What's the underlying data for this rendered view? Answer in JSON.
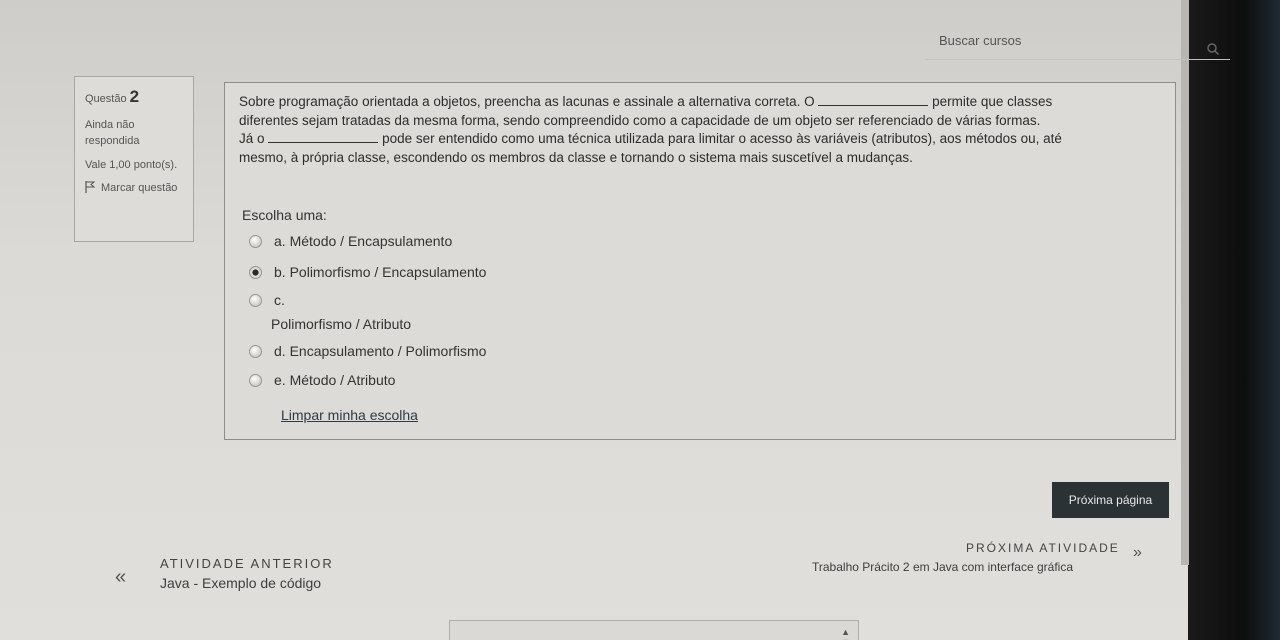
{
  "search": {
    "placeholder": "Buscar cursos"
  },
  "question_info": {
    "label": "Questão",
    "number": "2",
    "status": "Ainda não respondida",
    "grade": "Vale 1,00 ponto(s).",
    "flag_label": "Marcar questão"
  },
  "question": {
    "line1": "Sobre programação orientada a objetos, preencha as lacunas e assinale a alternativa correta. O",
    "line1_end": "permite que classes",
    "line2": "diferentes sejam tratadas da mesma forma, sendo compreendido como a capacidade de um objeto ser referenciado de várias formas.",
    "line3_start": "Já o",
    "line3_end": "pode ser entendido como uma técnica utilizada para limitar o acesso às variáveis (atributos), aos métodos ou, até",
    "line4": "mesmo, à própria classe, escondendo os membros da classe e tornando o sistema mais suscetível a mudanças.",
    "choose_label": "Escolha uma:",
    "options": [
      {
        "letter": "a.",
        "text": "Método / Encapsulamento",
        "selected": false
      },
      {
        "letter": "b.",
        "text": "Polimorfismo / Encapsulamento",
        "selected": true
      },
      {
        "letter": "c.",
        "text": "Polimorfismo / Atributo",
        "selected": false
      },
      {
        "letter": "d.",
        "text": "Encapsulamento / Polimorfismo",
        "selected": false
      },
      {
        "letter": "e.",
        "text": "Método / Atributo",
        "selected": false
      }
    ],
    "clear_label": "Limpar minha escolha"
  },
  "navigation": {
    "next_page_label": "Próxima página",
    "prev_activity_label": "ATIVIDADE ANTERIOR",
    "prev_activity_name": "Java - Exemplo de código",
    "next_activity_label": "PRÓXIMA ATIVIDADE",
    "next_activity_name": "Trabalho Prácito 2 em Java com interface gráfica",
    "prev_arrow": "«",
    "next_arrow": "»"
  }
}
